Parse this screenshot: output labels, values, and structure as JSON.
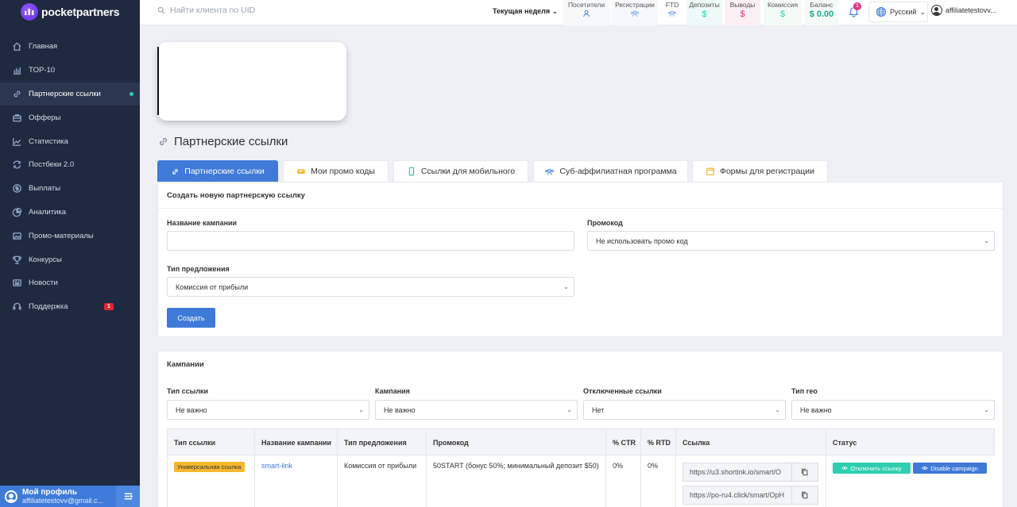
{
  "brand": {
    "name": "pocketpartners"
  },
  "sidebar": {
    "items": [
      {
        "label": "Главная",
        "icon": "home-icon"
      },
      {
        "label": "TOP-10",
        "icon": "bar-chart-icon"
      },
      {
        "label": "Партнерские ссылки",
        "icon": "link-icon",
        "active": true
      },
      {
        "label": "Офферы",
        "icon": "briefcase-icon"
      },
      {
        "label": "Статистика",
        "icon": "line-chart-icon"
      },
      {
        "label": "Постбеки 2.0",
        "icon": "refresh-icon"
      },
      {
        "label": "Выплаты",
        "icon": "dollar-circle-icon"
      },
      {
        "label": "Аналитика",
        "icon": "pie-chart-icon"
      },
      {
        "label": "Промо-материалы",
        "icon": "image-icon"
      },
      {
        "label": "Конкурсы",
        "icon": "trophy-icon"
      },
      {
        "label": "Новости",
        "icon": "newspaper-icon"
      },
      {
        "label": "Поддержка",
        "icon": "support-icon",
        "badge": "1"
      }
    ],
    "profile": {
      "name": "Мой профиль",
      "email": "affiliatetestovv@gmail.c..."
    }
  },
  "topbar": {
    "search_placeholder": "Найти клиента по UID",
    "period": "Текущая неделя",
    "stats": [
      {
        "label": "Посетители",
        "icon": "user-icon"
      },
      {
        "label": "Регистрации",
        "icon": "users-icon"
      },
      {
        "label": "FTD",
        "icon": "users-icon"
      },
      {
        "label": "Депозиты",
        "value": "$"
      },
      {
        "label": "Выводы",
        "value": "$"
      },
      {
        "label": "Комиссия",
        "value": "$"
      },
      {
        "label": "Баланс",
        "value": "$ 0.00"
      }
    ],
    "notifications": "1",
    "language": "Русский",
    "user": "affiliatetestovv..."
  },
  "page": {
    "title": "Партнерские ссылки"
  },
  "tabs": [
    {
      "label": "Партнерские ссылки",
      "icon": "link-icon",
      "active": true
    },
    {
      "label": "Мои промо коды",
      "icon": "ticket-icon"
    },
    {
      "label": "Ссылки для мобильного",
      "icon": "mobile-icon"
    },
    {
      "label": "Суб-аффилиатная программа",
      "icon": "users-icon"
    },
    {
      "label": "Формы для регистрации",
      "icon": "form-icon"
    }
  ],
  "create_form": {
    "title": "Создать новую партнерскую ссылку",
    "campaign_name_label": "Название кампании",
    "campaign_name_value": "",
    "promo_label": "Промокод",
    "promo_value": "Не использовать промо код",
    "offer_type_label": "Тип предложения",
    "offer_type_value": "Комиссия от прибыли",
    "submit": "Создать"
  },
  "campaigns": {
    "title": "Кампании",
    "filters": [
      {
        "label": "Тип ссылки",
        "value": "Не важно"
      },
      {
        "label": "Кампания",
        "value": "Не важно"
      },
      {
        "label": "Отключенные ссылки",
        "value": "Нет"
      },
      {
        "label": "Тип гео",
        "value": "Не важно"
      }
    ],
    "columns": [
      "Тип ссылки",
      "Название кампании",
      "Тип предложения",
      "Промокод",
      "% CTR",
      "% RTD",
      "Ссылка",
      "Статус"
    ],
    "rows": [
      {
        "link_type": "Универсальная ссылка",
        "campaign": "smart-link",
        "offer_type": "Комиссия от прибыли",
        "promo": "50START (бонус 50%; минимальный депозит $50)",
        "ctr": "0%",
        "rtd": "0%",
        "links": [
          "https://u3.shortink.io/smart/O",
          "https://po-ru4.click/smart/OpH"
        ],
        "status_buttons": [
          "Отключить ссылку",
          "Disable campaign"
        ]
      }
    ]
  },
  "colors": {
    "primary": "#3f7ad8",
    "sidebar": "#1f2940",
    "success": "#2ecfae",
    "danger": "#e02834",
    "warning": "#f5b82e",
    "pink": "#e0357f"
  }
}
